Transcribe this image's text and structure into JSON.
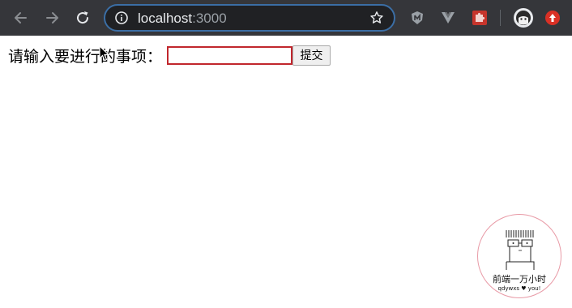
{
  "browser": {
    "url_host": "localhost",
    "url_port": ":3000",
    "accent_color": "#3b6ea5",
    "icons": [
      "back-icon",
      "forward-icon",
      "reload-icon",
      "info-icon",
      "star-icon",
      "shield-extension-icon",
      "vue-devtools-icon",
      "puzzle-extension-icon",
      "profile-avatar",
      "update-icon"
    ]
  },
  "page": {
    "prompt_label": "请输入要进行的事项：",
    "input_value": "",
    "submit_label": "提交"
  },
  "watermark": {
    "title": "前端一万小时",
    "subtitle": "qdywxs ♥ you!"
  }
}
